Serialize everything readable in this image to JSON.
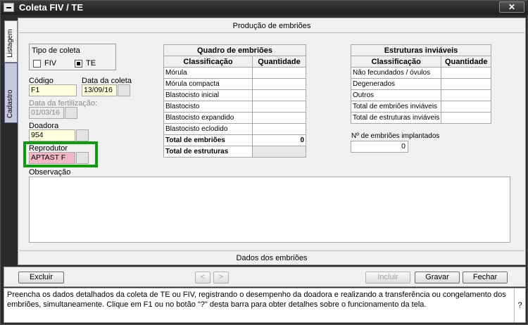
{
  "window": {
    "title": "Coleta FIV / TE",
    "close_label": "✕"
  },
  "side_tabs": {
    "listagem": "Listagem",
    "cadastro": "Cadastro"
  },
  "section_headers": {
    "producao": "Produção de embriões",
    "dados": "Dados dos embriões"
  },
  "tipo_coleta": {
    "label": "Tipo de coleta",
    "fiv_label": "FIV",
    "te_label": "TE",
    "selected": "TE"
  },
  "form": {
    "codigo_label": "Código",
    "codigo_value": "F1",
    "data_coleta_label": "Data da coleta",
    "data_coleta_value": "13/09/16",
    "data_fert_label": "Data da fertilização:",
    "data_fert_value": "01/03/16",
    "doadora_label": "Doadora",
    "doadora_value": "954",
    "reprodutor_label": "Reprodutor",
    "reprodutor_value": "APTAST F",
    "observacao_label": "Observação"
  },
  "quadro": {
    "title": "Quadro de embriões",
    "col1": "Classificação",
    "col2": "Quantidade",
    "rows": [
      "Mórula",
      "Mórula compacta",
      "Blastocisto inicial",
      "Blastocisto",
      "Blastocisto expandido",
      "Blastocisto eclodido"
    ],
    "total_embrioes_label": "Total de embriões",
    "total_embrioes_value": "0",
    "total_estruturas_label": "Total de estruturas"
  },
  "inviaveis": {
    "title": "Estruturas inviáveis",
    "col1": "Classificação",
    "col2": "Quantidade",
    "rows": [
      "Não fecundados / óvulos",
      "Degenerados",
      "Outros",
      "Total de embriões inviáveis",
      "Total de estruturas inviáveis"
    ],
    "implantados_label": "Nº de embriões implantados",
    "implantados_value": "0"
  },
  "buttons": {
    "excluir": "Excluir",
    "prev": "<",
    "next": ">",
    "incluir": "Incluir",
    "gravar": "Gravar",
    "fechar": "Fechar"
  },
  "help": {
    "text": "Preencha os dados detalhados da coleta de TE ou FIV, registrando o desempenho da doadora e realizando a transferência ou congelamento dos embriões, simultaneamente.  Clique em F1 ou no botão \"?\" desta barra para obter detalhes sobre o funcionamento da tela.",
    "question": "?"
  }
}
